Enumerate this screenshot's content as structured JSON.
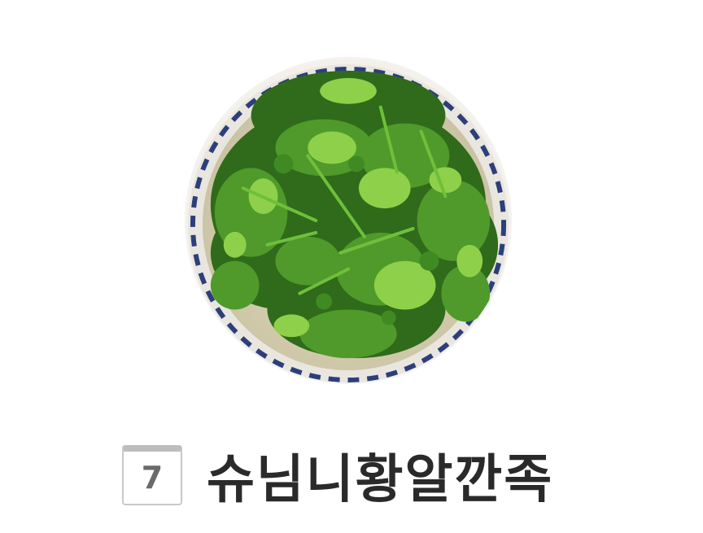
{
  "item": {
    "rank": "7",
    "title": "슈님니황알깐족"
  },
  "image": {
    "icon": "food-bowl-photo",
    "colors": {
      "leaf_dark": "#2f6b1a",
      "leaf_mid": "#4f9a2a",
      "leaf_light": "#8fd04a",
      "broth": "#d9d3b5",
      "sauce": "#7a1f0c",
      "bowl_blue": "#2d3f7a"
    }
  }
}
